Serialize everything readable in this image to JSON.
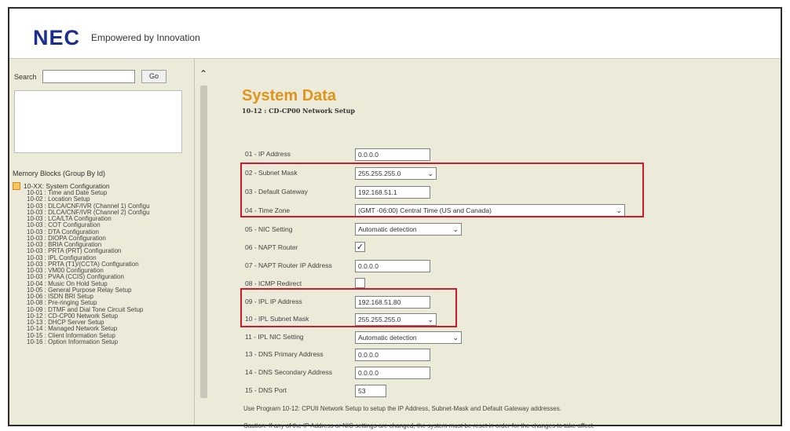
{
  "header": {
    "logo": "NEC",
    "tagline": "Empowered by Innovation"
  },
  "sidebar": {
    "search_label": "Search",
    "search_value": "",
    "go_label": "Go",
    "memory_blocks_title": "Memory Blocks (Group By Id)",
    "root_label": "10-XX: System Configuration",
    "items": [
      "10-01 : Time and Date Setup",
      "10-02 : Location Setup",
      "10-03 : DLCA/CNF/IVR (Channel 1) Configu",
      "10-03 : DLCA/CNF/IVR (Channel 2) Configu",
      "10-03 : LCA/LTA Configuration",
      "10-03 : COT Configuration",
      "10-03 : DTA Configuration",
      "10-03 : DIOPA Configuration",
      "10-03 : BRIA Configuration",
      "10-03 : PRTA (PRT) Configuration",
      "10-03 : IPL Configuration",
      "10-03 : PRTA (T1)/(CCTA) Configuration",
      "10-03 : VM00 Configuration",
      "10-03 : PVAA (CCIS) Configuration",
      "10-04 : Music On Hold Setup",
      "10-05 : General Purpose Relay Setup",
      "10-06 : ISDN BRI Setup",
      "10-08 : Pre-ringing Setup",
      "10-09 : DTMF and Dial Tone Circuit Setup",
      "10-12 : CD-CP00 Network Setup",
      "10-13 : DHCP Server Setup",
      "10-14 : Managed Network Setup",
      "10-15 : Client Information Setup",
      "10-16 : Option Information Setup"
    ],
    "selected_index": 19
  },
  "main": {
    "title": "System Data",
    "subtitle": "10-12 : CD-CP00 Network Setup",
    "rows": {
      "r01": {
        "label": "01 - IP Address",
        "value": "0.0.0.0"
      },
      "r02": {
        "label": "02 - Subnet Mask",
        "value": "255.255.255.0"
      },
      "r03": {
        "label": "03 - Default Gateway",
        "value": "192.168.51.1"
      },
      "r04": {
        "label": "04 - Time Zone",
        "value": "(GMT -06:00) Central Time (US and Canada)"
      },
      "r05": {
        "label": "05 - NIC Setting",
        "value": "Automatic detection"
      },
      "r06": {
        "label": "06 - NAPT Router",
        "checked": true
      },
      "r07": {
        "label": "07 - NAPT Router IP Address",
        "value": "0.0.0.0"
      },
      "r08": {
        "label": "08 - ICMP Redirect",
        "checked": false
      },
      "r09": {
        "label": "09 - IPL IP Address",
        "value": "192.168.51.80"
      },
      "r10": {
        "label": "10 - IPL Subnet Mask",
        "value": "255.255.255.0"
      },
      "r11": {
        "label": "11 - IPL NIC Setting",
        "value": "Automatic detection"
      },
      "r13": {
        "label": "13 - DNS Primary Address",
        "value": "0.0.0.0"
      },
      "r14": {
        "label": "14 - DNS Secondary Address",
        "value": "0.0.0.0"
      },
      "r15": {
        "label": "15 - DNS Port",
        "value": "53"
      }
    },
    "note1": "Use Program 10-12: CPUII Network Setup to setup the IP Address, Subnet-Mask and Default Gateway addresses.",
    "note2": "Caution: If any of the IP Address or NIC settings are changed, the system must be reset in order for the changes to take affect."
  },
  "colors": {
    "accent_title": "#e0941b",
    "highlight": "#d4182c",
    "brand": "#1a2e8c",
    "panel_bg": "#ecead8"
  }
}
